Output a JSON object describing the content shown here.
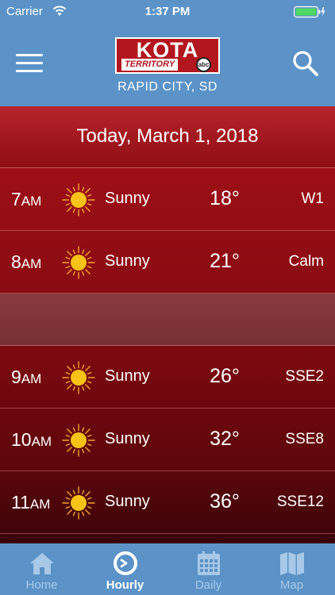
{
  "status_bar": {
    "carrier": "Carrier",
    "time": "1:37 PM"
  },
  "header": {
    "logo": {
      "name": "KOTA",
      "subtitle": "TERRITORY",
      "network": "abc"
    },
    "location": "RAPID CITY, SD"
  },
  "date_banner": "Today, March 1, 2018",
  "hourly": [
    {
      "hour": "7",
      "ampm": "AM",
      "condition": "Sunny",
      "icon": "sun-icon",
      "temp": "18°",
      "wind": "W1"
    },
    {
      "hour": "8",
      "ampm": "AM",
      "condition": "Sunny",
      "icon": "sun-icon",
      "temp": "21°",
      "wind": "Calm"
    },
    {
      "hour": "9",
      "ampm": "AM",
      "condition": "Sunny",
      "icon": "sun-icon",
      "temp": "26°",
      "wind": "SSE2"
    },
    {
      "hour": "10",
      "ampm": "AM",
      "condition": "Sunny",
      "icon": "sun-icon",
      "temp": "32°",
      "wind": "SSE8"
    },
    {
      "hour": "11",
      "ampm": "AM",
      "condition": "Sunny",
      "icon": "sun-icon",
      "temp": "36°",
      "wind": "SSE12"
    }
  ],
  "tabs": [
    {
      "label": "Home",
      "icon": "home-icon"
    },
    {
      "label": "Hourly",
      "icon": "clock-icon",
      "active": true
    },
    {
      "label": "Daily",
      "icon": "calendar-icon"
    },
    {
      "label": "Map",
      "icon": "map-icon"
    }
  ],
  "colors": {
    "header_blue": "#5b93c8",
    "banner_red": "#b3161e",
    "sun_yellow": "#f7c316"
  }
}
